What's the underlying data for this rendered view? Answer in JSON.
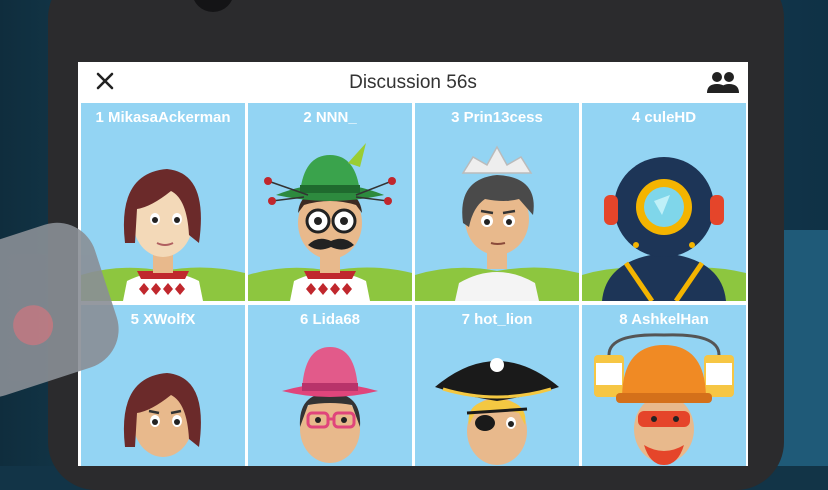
{
  "header": {
    "title": "Discussion 56s",
    "close_icon": "close-icon",
    "participants_icon": "people-icon"
  },
  "players": [
    {
      "label": "1 MikasaAckerman",
      "avatar": "red-hair-girl"
    },
    {
      "label": "2 NNN_",
      "avatar": "hat-glasses-mustache"
    },
    {
      "label": "3 Prin13cess",
      "avatar": "paper-boat-hat"
    },
    {
      "label": "4 culeHD",
      "avatar": "diving-helmet"
    },
    {
      "label": "5 XWolfX",
      "avatar": "red-hair-girl"
    },
    {
      "label": "6 Lida68",
      "avatar": "pink-hat-glasses"
    },
    {
      "label": "7 hot_lion",
      "avatar": "pirate"
    },
    {
      "label": "8 AshkelHan",
      "avatar": "hardhat-cans"
    }
  ],
  "colors": {
    "tile_bg": "#93d4f3",
    "grass": "#8dc63f",
    "skin": "#e8b98c",
    "hair_red": "#6b2a2a"
  }
}
